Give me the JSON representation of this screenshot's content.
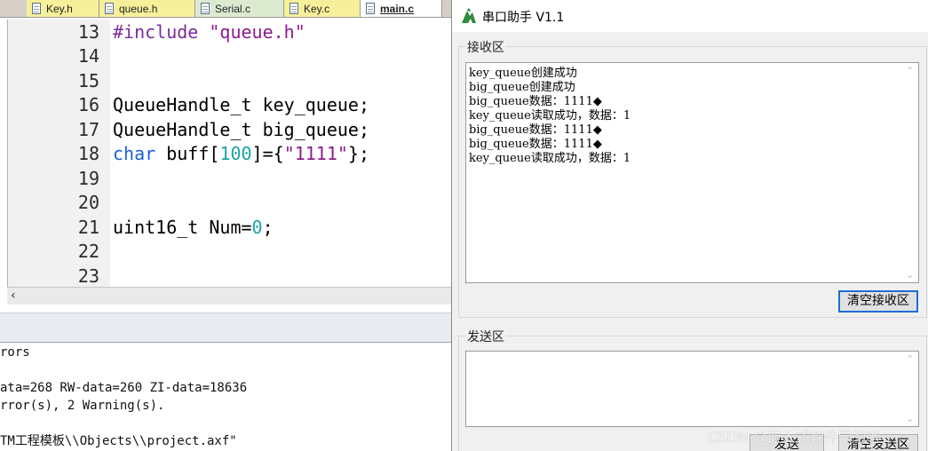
{
  "ide": {
    "tabs": [
      {
        "label": "Key.h"
      },
      {
        "label": "queue.h"
      },
      {
        "label": "Serial.c"
      },
      {
        "label": "Key.c"
      },
      {
        "label": "main.c"
      }
    ],
    "editor": {
      "line_numbers": [
        "13",
        "14",
        "15",
        "16",
        "17",
        "18",
        "19",
        "20",
        "21",
        "22",
        "23"
      ],
      "line13": {
        "directive": "#include",
        "header": "\"queue.h\""
      },
      "line16": "QueueHandle_t key_queue;",
      "line17": "QueueHandle_t big_queue;",
      "line18": {
        "keyword": "char",
        "decl": "buff[",
        "size": "100",
        "eq": "]={",
        "string": "\"1111\"",
        "end": "};"
      },
      "line21": {
        "decl": "uint16_t Num=",
        "value": "0",
        "end": ";"
      }
    },
    "output": {
      "lines": [
        "rors",
        "",
        "ata=268 RW-data=260 ZI-data=18636",
        "rror(s), 2 Warning(s).",
        "",
        "TM工程模板\\\\Objects\\\\project.axf\""
      ]
    }
  },
  "serial": {
    "title": "串口助手 V1.1",
    "receive": {
      "group_label": "接收区",
      "lines": [
        "key_queue创建成功",
        "big_queue创建成功",
        "big_queue数据：1111◆",
        "key_queue读取成功，数据：1",
        "big_queue数据：1111◆",
        "big_queue数据：1111◆",
        "key_queue读取成功，数据：1"
      ],
      "clear_button": "清空接收区"
    },
    "send": {
      "group_label": "发送区",
      "value": "",
      "send_button": "发送",
      "clear_button": "清空发送区"
    }
  },
  "watermark": "CSDN @嵌入式软件学习者",
  "colors": {
    "preprocessor": "#7b2b9a",
    "string": "#8d1a8d",
    "keyword": "#1b5fd6",
    "number": "#1ea3a3",
    "focus_border": "#1e6ed6"
  }
}
